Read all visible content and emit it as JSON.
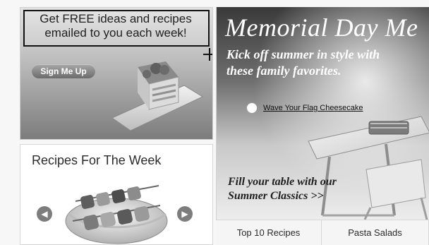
{
  "promo": {
    "headline_line1": "Get FREE ideas and recipes",
    "headline_line2": "emailed to you each week!",
    "signup_label": "Sign Me Up"
  },
  "week": {
    "title": "Recipes For The Week",
    "prev_icon": "chevron-left-icon",
    "next_icon": "chevron-right-icon"
  },
  "hero": {
    "title": "Memorial Day Me",
    "subtitle_line1": "Kick off summer in style with",
    "subtitle_line2": "these family favorites.",
    "feature_link": "Wave Your Flag Cheesecake",
    "cta_line1": "Fill your table with our",
    "cta_line2": "Summer Classics >>"
  },
  "tabs": [
    {
      "label": "Top 10 Recipes"
    },
    {
      "label": "Pasta Salads"
    }
  ],
  "colors": {
    "text": "#1f1f1f",
    "button": "#7d7d7d",
    "border": "#d7d7d7"
  }
}
